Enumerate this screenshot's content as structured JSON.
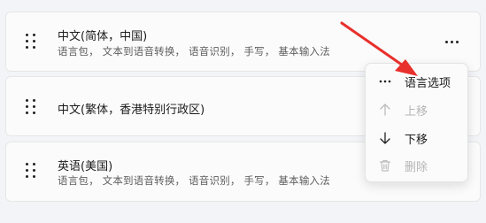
{
  "languages": [
    {
      "title": "中文(简体，中国)",
      "features": "语言包， 文本到语音转换， 语音识别， 手写， 基本输入法"
    },
    {
      "title": "中文(繁体，香港特别行政区)"
    },
    {
      "title": "英语(美国)",
      "features": "语言包， 文本到语音转换， 语音识别， 手写， 基本输入法"
    }
  ],
  "context_menu": {
    "items": [
      {
        "label": "语言选项",
        "icon": "more-horizontal-icon",
        "enabled": true
      },
      {
        "label": "上移",
        "icon": "arrow-up-icon",
        "enabled": false
      },
      {
        "label": "下移",
        "icon": "arrow-down-icon",
        "enabled": true
      },
      {
        "label": "删除",
        "icon": "trash-icon",
        "enabled": false
      }
    ]
  },
  "colors": {
    "annotation_arrow": "#e8302c",
    "disabled_text": "#b5b5b5"
  }
}
